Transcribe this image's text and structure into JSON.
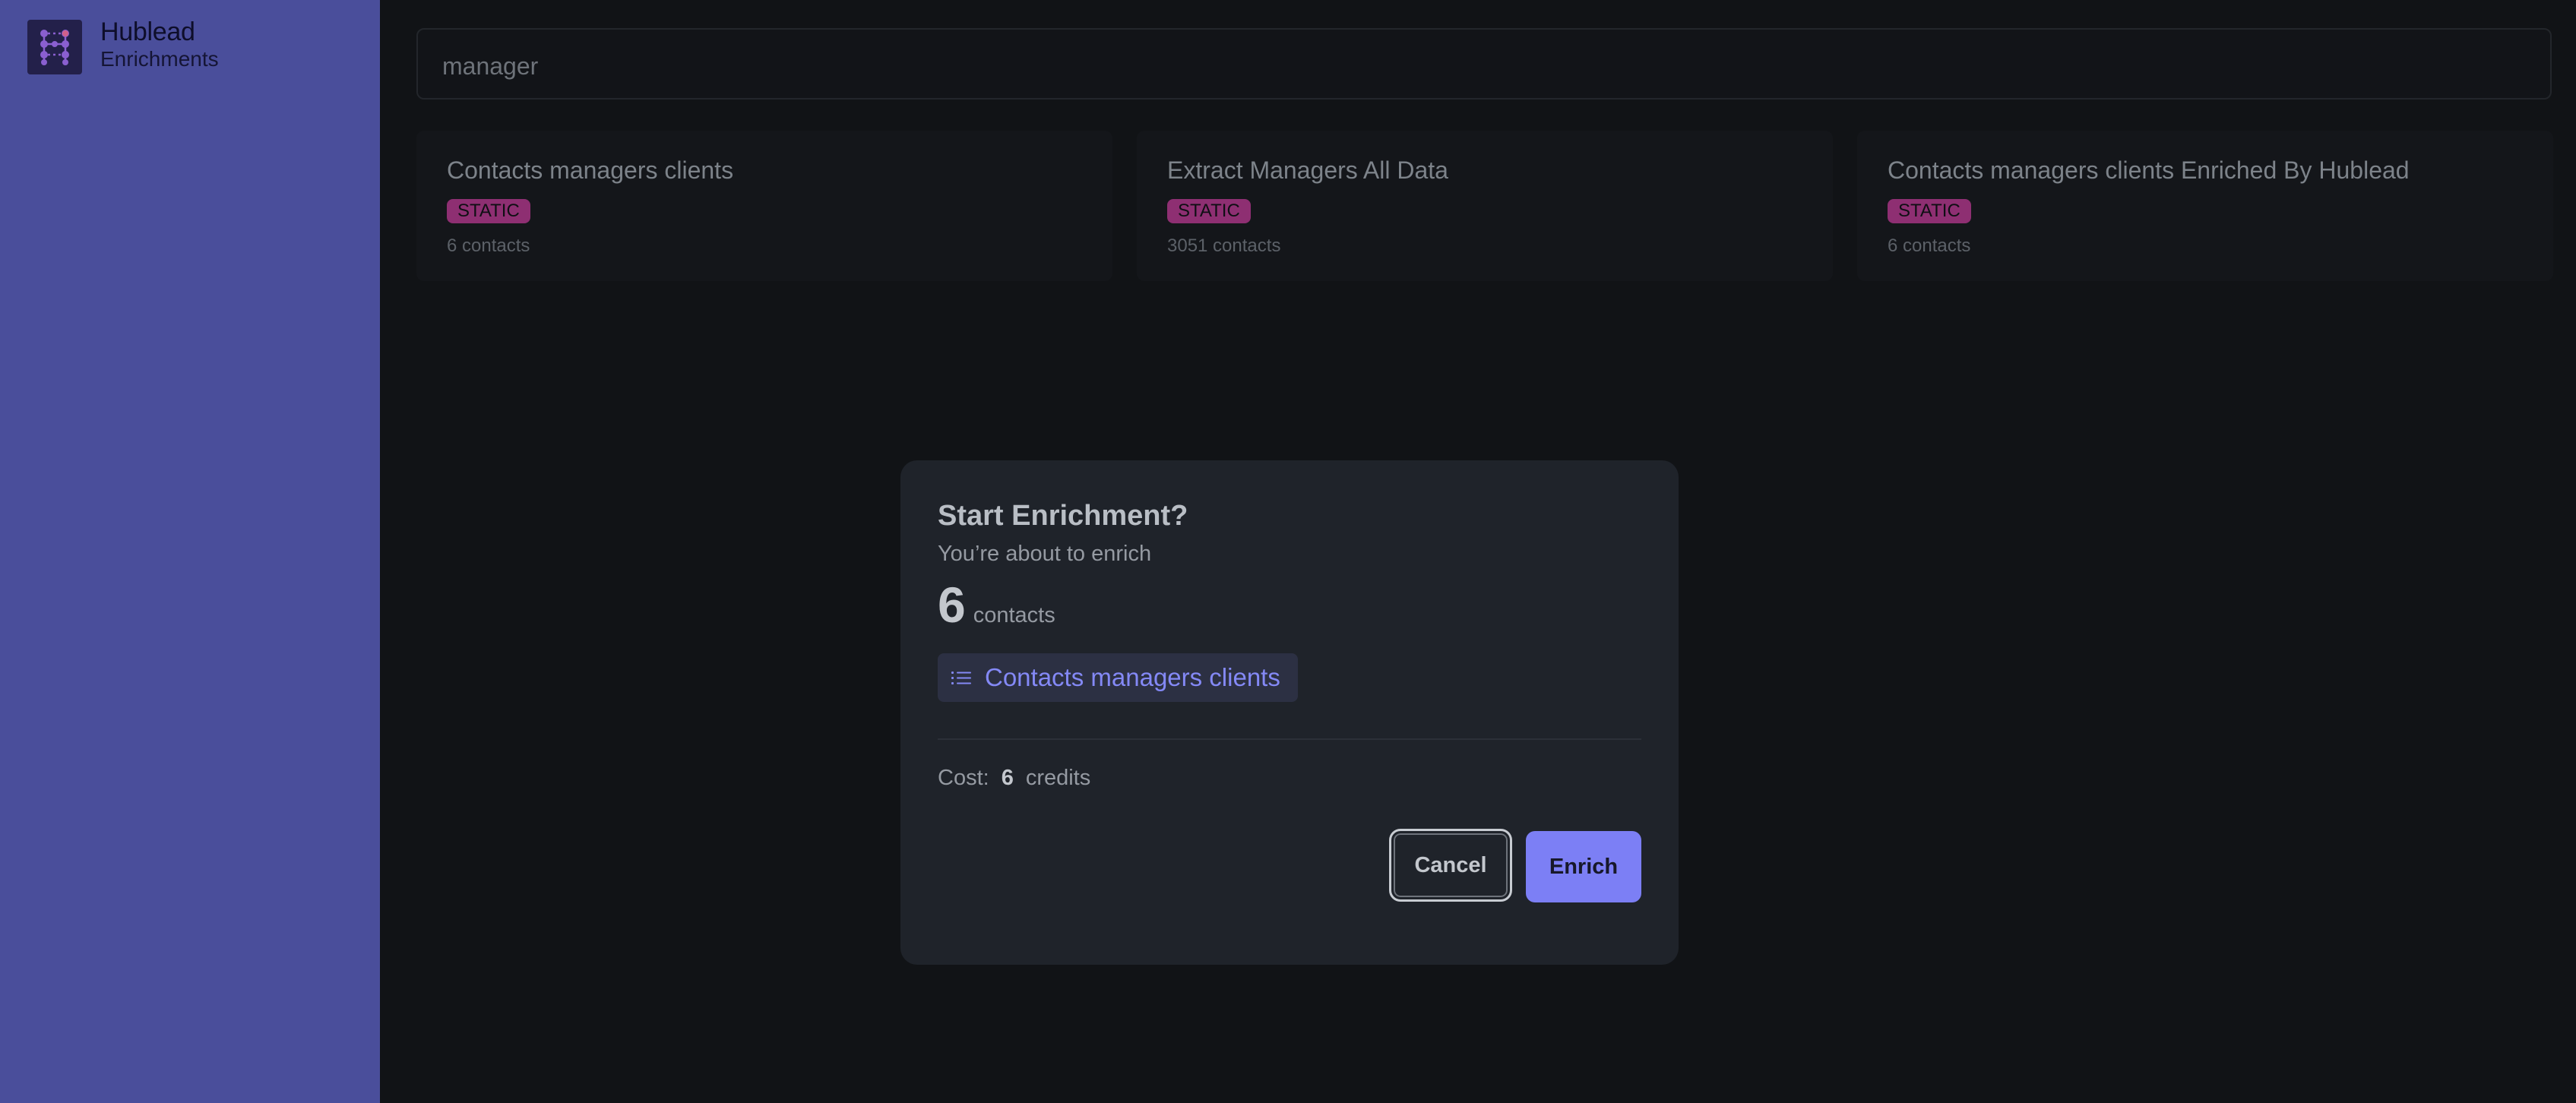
{
  "brand": {
    "name": "Hublead",
    "subtitle": "Enrichments"
  },
  "search": {
    "value": "manager"
  },
  "cards": [
    {
      "title": "Contacts managers clients",
      "badge": "STATIC",
      "count": "6 contacts"
    },
    {
      "title": "Extract Managers All Data",
      "badge": "STATIC",
      "count": "3051 contacts"
    },
    {
      "title": "Contacts managers clients Enriched By Hublead",
      "badge": "STATIC",
      "count": "6 contacts"
    }
  ],
  "modal": {
    "title": "Start Enrichment?",
    "subtitle": "You’re about to enrich",
    "count": "6",
    "count_unit": "contacts",
    "list_icon": "list-icon",
    "list_name": "Contacts managers clients",
    "cost_label": "Cost:",
    "cost_value": "6",
    "cost_unit": "credits",
    "cancel_label": "Cancel",
    "enrich_label": "Enrich"
  },
  "colors": {
    "sidebar": "#4a4e9b",
    "accent": "#7c7ff5",
    "badge": "#8e2f72",
    "background": "#111316",
    "modal": "#1f232a"
  }
}
